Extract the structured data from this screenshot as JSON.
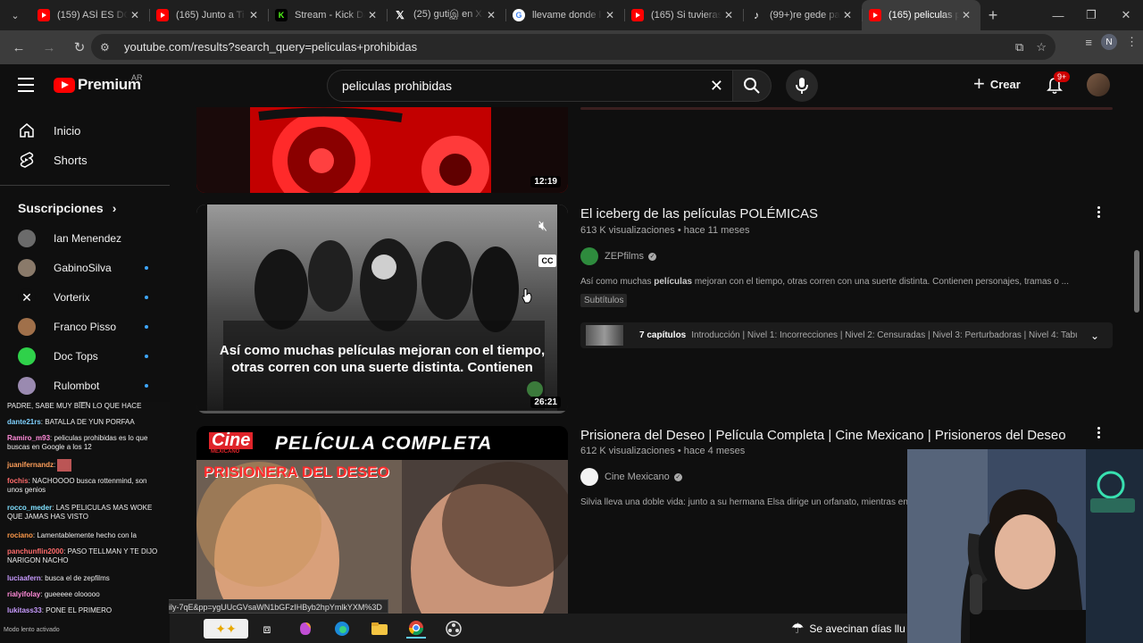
{
  "browser": {
    "tabs": [
      {
        "title": "(159) ASÍ ES DO",
        "favicon": "youtube",
        "color": "#ff0000"
      },
      {
        "title": "(165) Junto a Ti",
        "favicon": "youtube",
        "color": "#ff0000"
      },
      {
        "title": "Stream - Kick Da",
        "favicon": "kick",
        "color": "#53fc18"
      },
      {
        "title": "(25) gutiஇ en X:",
        "favicon": "x",
        "color": "#ffffff"
      },
      {
        "title": "llevame donde l",
        "favicon": "google",
        "color": "#4285f4"
      },
      {
        "title": "(165) Si tuvieras",
        "favicon": "youtube",
        "color": "#ff0000"
      },
      {
        "title": "(99+)re gede pa",
        "favicon": "tiktok",
        "color": "#ffffff"
      },
      {
        "title": "(165) peliculas p",
        "favicon": "youtube",
        "color": "#ff0000",
        "active": true
      }
    ],
    "url": "youtube.com/results?search_query=peliculas+prohibidas",
    "profile_initial": "N"
  },
  "masthead": {
    "logo_text": "Premium",
    "country": "AR",
    "search_value": "peliculas prohibidas",
    "create_label": "Crear",
    "notif_badge": "9+"
  },
  "sidebar": {
    "home": "Inicio",
    "shorts": "Shorts",
    "subscriptions_title": "Suscripciones",
    "subs": [
      {
        "name": "Ian Menendez",
        "color": "#6b6b6b",
        "dot": false
      },
      {
        "name": "GabinoSilva",
        "color": "#8a7a6a",
        "dot": true
      },
      {
        "name": "Vorterix",
        "color": "#0f0f0f",
        "dot": true
      },
      {
        "name": "Franco Pisso",
        "color": "#a0704a",
        "dot": true
      },
      {
        "name": "Doc Tops",
        "color": "#2fd14a",
        "dot": true
      },
      {
        "name": "Rulombot",
        "color": "#9a8ab0",
        "dot": true
      }
    ]
  },
  "chat": {
    "messages": [
      {
        "user": "",
        "text": "PADRE, SABE MUY BIEN LO QUE HACE",
        "color": "#ffffff"
      },
      {
        "user": "dante21rs",
        "text": "BATALLA DE YUN PORFAA",
        "color": "#7fd1ff"
      },
      {
        "user": "Ramiro_m93",
        "text": "peliculas prohibidas es lo que buscas en Google a los 12",
        "color": "#ff8ad8"
      },
      {
        "user": "juanifernandz",
        "text": "",
        "color": "#ff9f5a"
      },
      {
        "user": "fochis",
        "text": "NACHOOOO busca rottenmind, son unos genios",
        "color": "#ff6b6b"
      },
      {
        "user": "rocco_meder",
        "text": "LAS PELICULAS MAS WOKE QUE JAMAS HAS VISTO",
        "color": "#7fe0ff"
      },
      {
        "user": "rociano",
        "text": "Lamentablemente hecho con la",
        "color": "#ff9a4a"
      },
      {
        "user": "panchunflin2000",
        "text": "PASO TELLMAN Y TE DIJO NARIGON NACHO",
        "color": "#ff6b6b"
      },
      {
        "user": "luciaafern",
        "text": "busca el de zepfilms",
        "color": "#c89bff"
      },
      {
        "user": "rialyifolay",
        "text": "gueeeee olooooo",
        "color": "#ff8ad8"
      },
      {
        "user": "lukitass33",
        "text": "PONE EL PRIMERO",
        "color": "#c89bff"
      }
    ],
    "footer": "Modo lento activado"
  },
  "results": [
    {
      "duration": "12:19"
    },
    {
      "title": "El iceberg de las películas POLÉMICAS",
      "meta": "613 K visualizaciones • hace 11 meses",
      "channel": "ZEPfilms",
      "desc_prefix": "Así como muchas ",
      "desc_bold": "películas",
      "desc_suffix": " mejoran con el tiempo, otras corren con una suerte distinta. Contienen personajes, tramas o ...",
      "chip": "Subtítulos",
      "chapters_count": "7 capítulos",
      "chapters_list": "Introducción | Nivel 1: Incorrecciones | Nivel 2: Censuradas | Nivel 3: Perturbadoras | Nivel 4: Tabúe...",
      "duration": "26:21",
      "caption": "Así como muchas películas mejoran con el tiempo, otras corren con una suerte distinta. Contienen"
    },
    {
      "title": "Prisionera del Deseo | Película Completa | Cine Mexicano | Prisioneros del Deseo",
      "meta": "612 K visualizaciones • hace 4 meses",
      "channel": "Cine Mexicano",
      "desc": "Silvia lleva una doble vida: junto a su hermana Elsa dirige un orfanato, mientras en s",
      "thumb_banner": "PELÍCULA COMPLETA",
      "thumb_brand": "Cine",
      "thumb_brand_sub": "MEXICANO",
      "thumb_title": "PRISIONERA DEL DESEO"
    }
  ],
  "status_url": "ily-7qE&pp=ygUUcGVsaWN1bGFzIHByb2hpYmlkYXM%3D",
  "weather_text": "Se avecinan días llu"
}
